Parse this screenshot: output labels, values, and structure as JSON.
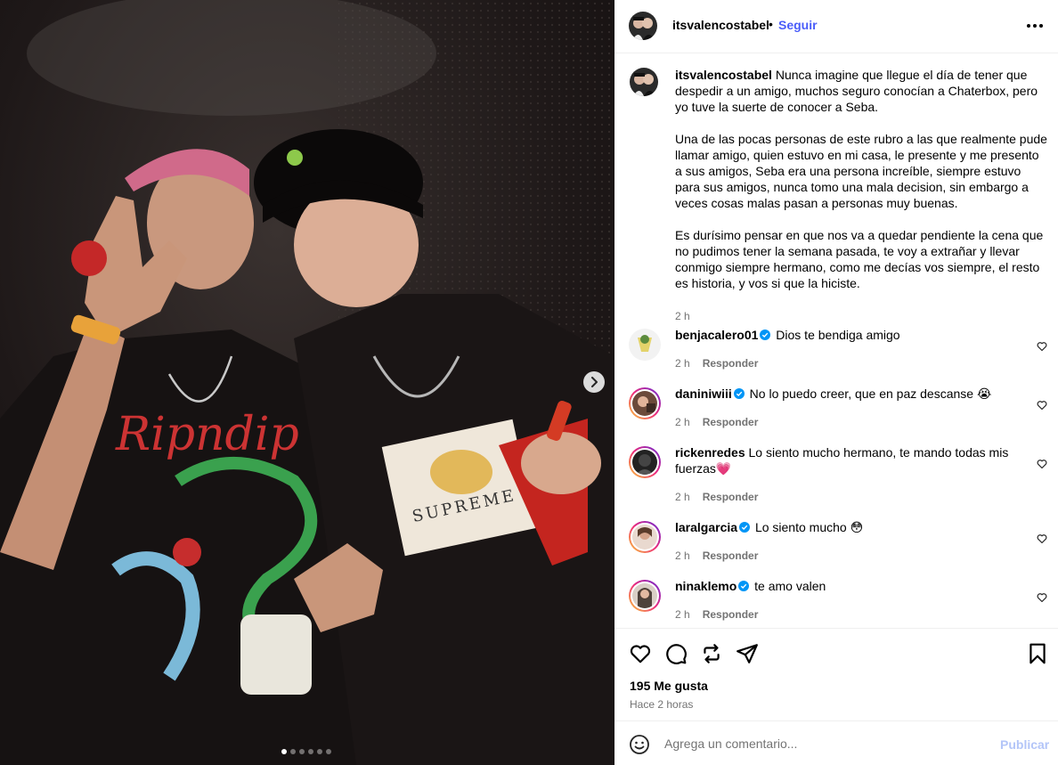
{
  "post": {
    "username": "itsvalencostabel",
    "separator": "•",
    "follow_label": "Seguir",
    "more_icon": "more-horizontal-icon",
    "caption": "Nunca imagine que llegue el día de tener que despedir a un amigo, muchos seguro conocían a Chaterbox, pero yo tuve la suerte de conocer a Seba.\n\nUna de las pocas personas de este rubro a las que realmente pude llamar amigo, quien estuvo en mi casa, le presente y me presento a sus amigos, Seba era una persona increíble, siempre estuvo para sus amigos, nunca tomo una mala decision, sin embargo a veces cosas malas pasan a personas muy buenas.\n\nEs durísimo pensar en que nos va a quedar pendiente la cena que no pudimos tener la semana pasada, te voy a extrañar y llevar conmigo siempre hermano, como me decías vos siempre, el resto es historia, y vos si que la hiciste.",
    "caption_time": "2 h",
    "likes": "195 Me gusta",
    "posted_ago": "Hace 2 horas"
  },
  "media": {
    "photo_text": "Ripndip",
    "shirt_text": "SUPREME",
    "carousel_count": 6,
    "carousel_active": 0
  },
  "comments": [
    {
      "user": "benjacalero01",
      "verified": true,
      "text": "Dios te bendiga amigo",
      "time": "2 h",
      "reply": "Responder",
      "story_ring": false
    },
    {
      "user": "daniniwiii",
      "verified": true,
      "text": "No lo puedo creer, que en paz descanse 😭",
      "time": "2 h",
      "reply": "Responder",
      "story_ring": true
    },
    {
      "user": "rickenredes",
      "verified": false,
      "text": "Lo siento mucho hermano, te mando todas mis fuerzas💗",
      "time": "2 h",
      "reply": "Responder",
      "story_ring": true
    },
    {
      "user": "laralgarcia",
      "verified": true,
      "text": "Lo siento mucho 😳",
      "time": "2 h",
      "reply": "Responder",
      "story_ring": true
    },
    {
      "user": "ninaklemo",
      "verified": true,
      "text": "te amo valen",
      "time": "2 h",
      "reply": "Responder",
      "story_ring": true
    }
  ],
  "compose": {
    "placeholder": "Agrega un comentario...",
    "post_label": "Publicar"
  },
  "colors": {
    "link_blue": "#4a5df9",
    "verified_blue": "#0095f6",
    "muted": "#737373",
    "post_disabled": "#b3c5f8"
  }
}
